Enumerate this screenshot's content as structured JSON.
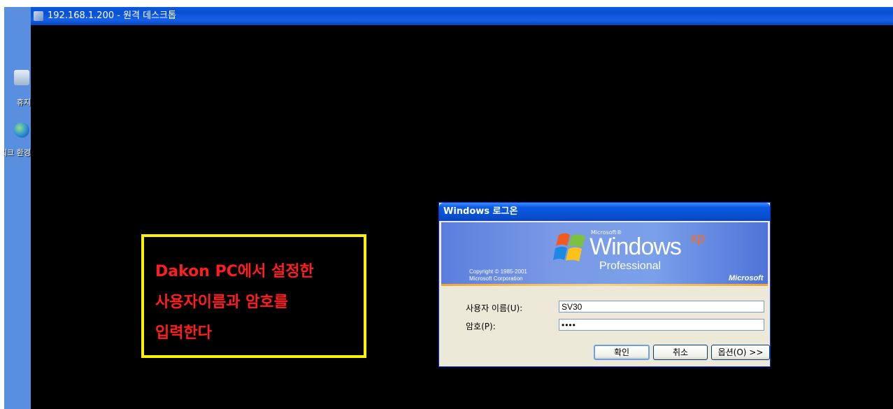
{
  "desktop": {
    "icons": [
      {
        "label": "휴지"
      },
      {
        "label": "내 네트워크 환경"
      }
    ]
  },
  "rdp_window": {
    "title": "192.168.1.200 - 원격 데스크톱"
  },
  "callout": {
    "lines": [
      "Dakon PC에서 설정한",
      "사용자이름과 암호를",
      "입력한다"
    ],
    "border_color": "#fff200",
    "text_color": "#ff1e1e"
  },
  "logon_dialog": {
    "title": "Windows 로그온",
    "banner": {
      "microsoft_small": "Microsoft®",
      "windows": "Windows",
      "xp": "xp",
      "edition": "Professional",
      "copyright_line1": "Copyright © 1985-2001",
      "copyright_line2": "Microsoft Corporation",
      "brand": "Microsoft"
    },
    "username_label": "사용자 이름(U):",
    "username_value": "SV30",
    "password_label": "암호(P):",
    "password_value": "••••",
    "buttons": {
      "ok": "확인",
      "cancel": "취소",
      "options": "옵션(O) >>"
    }
  }
}
